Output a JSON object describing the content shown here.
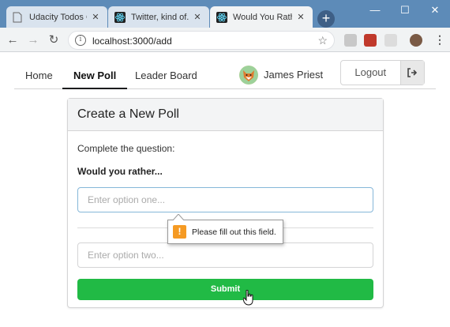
{
  "browser": {
    "tabs": [
      {
        "title": "Udacity Todos Goa"
      },
      {
        "title": "Twitter, kind of."
      },
      {
        "title": "Would You Rather C"
      }
    ],
    "url": "localhost:3000/add",
    "new_tab": "+",
    "window_controls": {
      "minimize": "—",
      "maximize": "☐",
      "close": "✕"
    }
  },
  "nav": {
    "items": [
      {
        "label": "Home"
      },
      {
        "label": "New Poll"
      },
      {
        "label": "Leader Board"
      }
    ],
    "user_name": "James Priest",
    "logout_label": "Logout"
  },
  "form": {
    "title": "Create a New Poll",
    "prompt": "Complete the question:",
    "subtitle": "Would you rather...",
    "option_one_placeholder": "Enter option one...",
    "option_two_placeholder": "Enter option two...",
    "submit_label": "Submit"
  },
  "validation": {
    "message": "Please fill out this field.",
    "icon": "!"
  },
  "colors": {
    "titlebar": "#5d8bb8",
    "submit": "#21ba45",
    "warning": "#f59a23",
    "focus_border": "#85b7d9"
  }
}
